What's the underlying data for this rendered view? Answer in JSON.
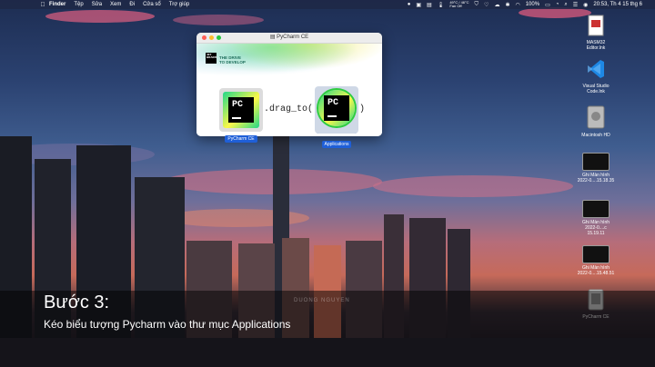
{
  "menubar": {
    "app": "Finder",
    "items": [
      "Tệp",
      "Sửa",
      "Xem",
      "Đi",
      "Cửa sổ",
      "Trợ giúp"
    ],
    "weather": "49°C / 46°C",
    "fan": "Fan Off",
    "battery": "100%",
    "clock": "20:53, Th 4 15 thg 6"
  },
  "window": {
    "title": "PyCharm CE",
    "tagline_line1": "THE DRIVE",
    "tagline_line2": "TO DEVELOP",
    "jb_text": "JET BRAINS",
    "left_icon_label": "PyCharm CE",
    "drag_text": ".drag_to(",
    "drag_close": ")",
    "right_icon_label_top": "PyCharm CE",
    "right_icon_label": "Applications"
  },
  "desktop": {
    "items": [
      {
        "label1": "MASM32",
        "label2": "Editor.lnk",
        "icon": "document-icon"
      },
      {
        "label1": "Visual Studio",
        "label2": "Code.lnk",
        "icon": "vscode-icon"
      },
      {
        "label1": "Macintosh HD",
        "label2": "",
        "icon": "hard-drive-icon"
      },
      {
        "label1": "Ghi Màn hình",
        "label2": "2022-0....15.18.35",
        "icon": "screenshot-icon"
      },
      {
        "label1": "Ghi Màn hình",
        "label2": "2022-0....c 15.19.11",
        "icon": "screenshot-icon"
      },
      {
        "label1": "Ghi Màn hình",
        "label2": "2022-0....15.48.51",
        "icon": "screenshot-icon"
      },
      {
        "label1": "PyCharm CE",
        "label2": "",
        "icon": "disk-image-icon"
      }
    ]
  },
  "caption": {
    "title": "Bước 3:",
    "subtitle": "Kéo biểu tượng Pycharm vào thư mục Applications",
    "watermark": "DUONG NGUYEN"
  },
  "colors": {
    "accent_blue": "#1f5fd8",
    "pycharm_green": "#21d789",
    "pycharm_yellow": "#fcf84a"
  }
}
